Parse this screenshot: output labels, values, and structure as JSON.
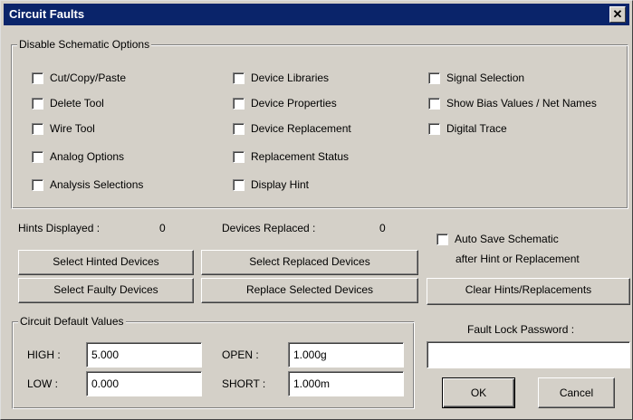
{
  "window": {
    "title": "Circuit Faults",
    "close_glyph": "✕"
  },
  "disable_options": {
    "group_label": "Disable Schematic Options",
    "col1": [
      "Cut/Copy/Paste",
      "Delete Tool",
      "Wire Tool",
      "Analog Options",
      "Analysis Selections"
    ],
    "col2": [
      "Device Libraries",
      "Device Properties",
      "Device Replacement",
      "Replacement Status",
      "Display Hint"
    ],
    "col3": [
      "Signal Selection",
      "Show Bias Values / Net Names",
      "Digital Trace"
    ]
  },
  "counts": {
    "hints_label": "Hints Displayed :",
    "hints_value": "0",
    "replaced_label": "Devices Replaced :",
    "replaced_value": "0"
  },
  "auto_save": {
    "line1": "Auto Save Schematic",
    "line2": "after Hint or Replacement"
  },
  "buttons": {
    "select_hinted": "Select Hinted Devices",
    "select_replaced": "Select Replaced Devices",
    "select_faulty": "Select Faulty Devices",
    "replace_selected": "Replace Selected Devices",
    "clear_hints": "Clear Hints/Replacements",
    "ok": "OK",
    "cancel": "Cancel"
  },
  "defaults": {
    "group_label": "Circuit Default Values",
    "high_label": "HIGH :",
    "high_value": "5.000",
    "low_label": "LOW :",
    "low_value": "0.000",
    "open_label": "OPEN :",
    "open_value": "1.000g",
    "short_label": "SHORT :",
    "short_value": "1.000m"
  },
  "password": {
    "label": "Fault Lock Password :",
    "value": ""
  }
}
